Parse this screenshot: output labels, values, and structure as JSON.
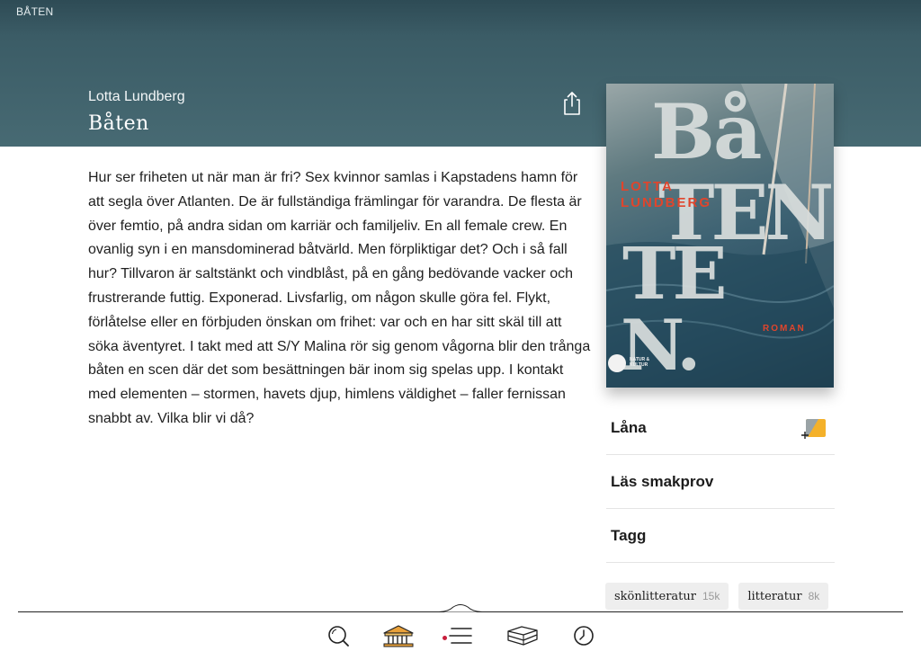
{
  "status_bar": {
    "title": "BÅTEN"
  },
  "book": {
    "author": "Lotta Lundberg",
    "title": "Båten",
    "description": "Hur ser friheten ut när man är fri? Sex kvinnor samlas i Kapstadens hamn för att segla över Atlanten. De är fullständiga främlingar för varandra. De flesta är över femtio, på andra sidan om karriär och familjeliv. En all female crew. En ovanlig syn i en mansdominerad båtvärld. Men förpliktigar det? Och i så fall hur? Tillvaron är saltstänkt och vindblåst, på en gång bedövande vacker och frustrerande futtig. Exponerad. Livsfarlig, om någon skulle göra fel. Flykt, förlåtelse eller en förbjuden önskan om frihet: var och en har sitt skäl till att söka äventyret. I takt med att S/Y Malina rör sig genom vågorna blir den trånga båten en scen där det som besättningen bär inom sig spelas upp. I kontakt med elementen – stormen, havets djup, himlens väldighet – faller fernissan snabbt av. Vilka blir vi då?"
  },
  "cover": {
    "author_line_1": "LOTTA",
    "author_line_2": "LUNDBERG",
    "letters_1": "Bå",
    "letters_2": "TEN",
    "letters_3": "TE",
    "letters_4": "N.",
    "genre": "ROMAN",
    "publisher": "NATUR & KULTUR",
    "accent_color": "#e0452c"
  },
  "actions": {
    "loan_label": "Låna",
    "sample_label": "Läs smakprov",
    "tags_label": "Tagg"
  },
  "tags": [
    {
      "name": "skönlitteratur",
      "count": "15k"
    },
    {
      "name": "litteratur",
      "count": "8k"
    }
  ],
  "tabbar": {
    "items": [
      "search-icon",
      "library-icon",
      "menu-icon",
      "books-icon",
      "history-icon"
    ]
  },
  "colors": {
    "header": "#476a73",
    "notification_dot": "#c81e3c"
  }
}
